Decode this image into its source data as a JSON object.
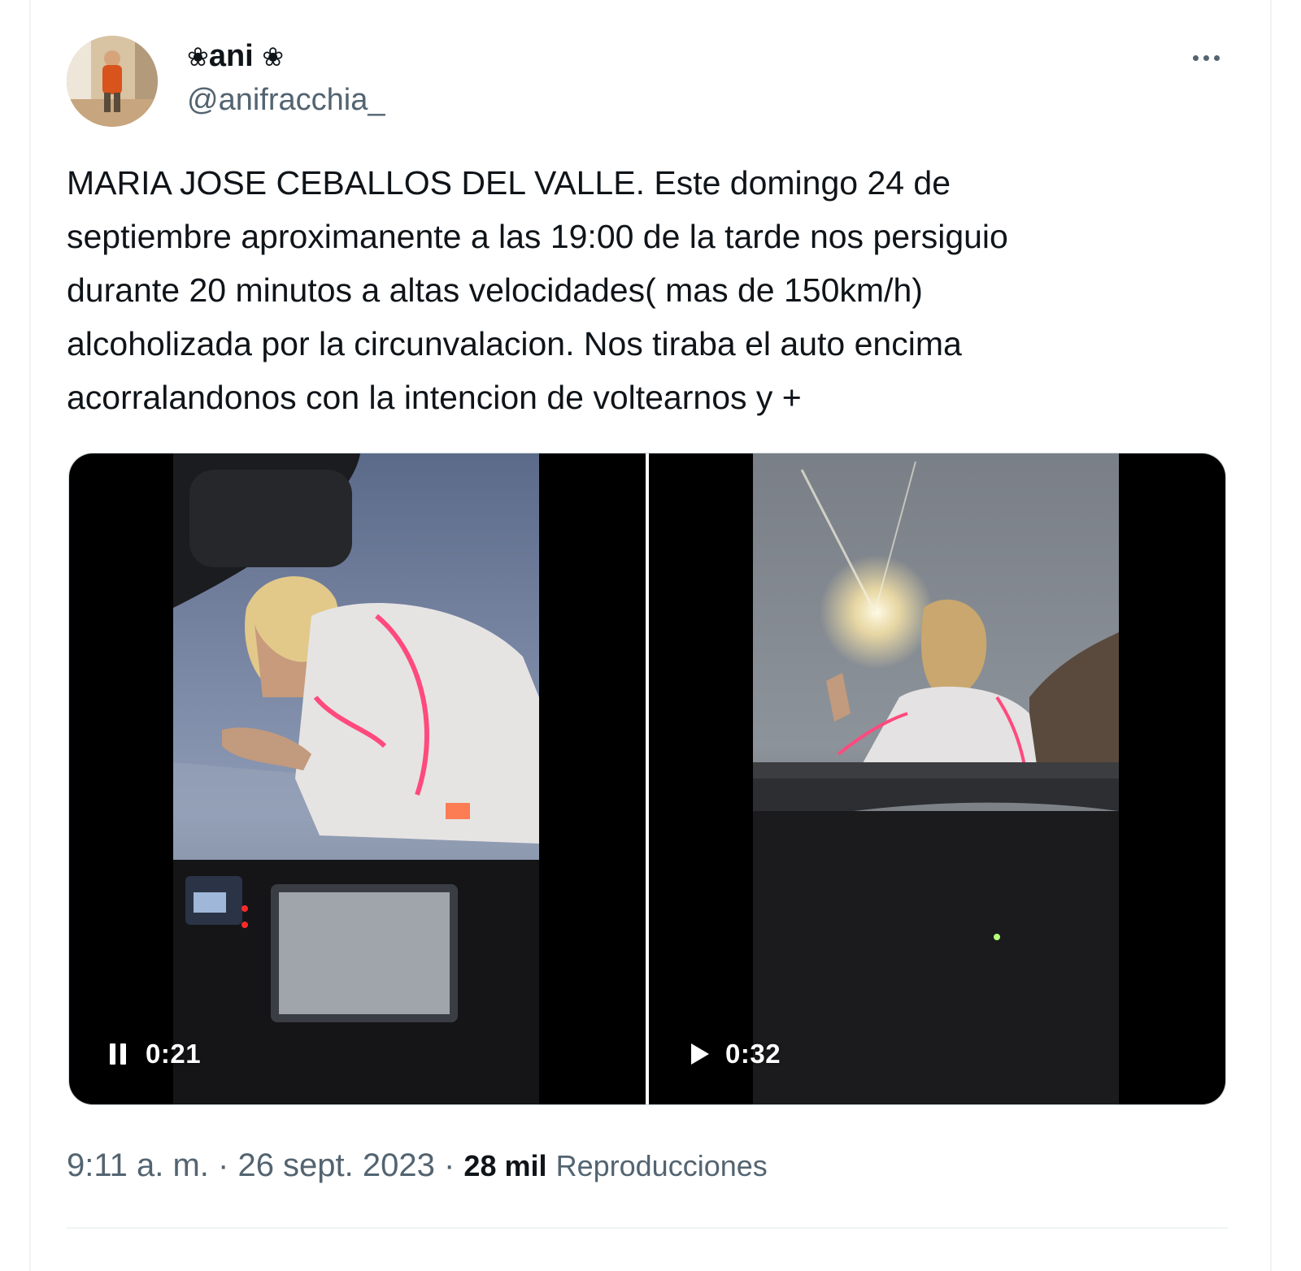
{
  "author": {
    "display_name": "ani",
    "flower_prefix": "❀",
    "flower_suffix": "❀",
    "handle": "@anifracchia_",
    "avatar_icon": "avatar-photo"
  },
  "more_icon": "more-horizontal-icon",
  "tweet": {
    "text": "MARIA JOSE CEBALLOS DEL VALLE. Este domingo 24 de\nseptiembre aproximanente a las 19:00 de la tarde nos persiguio\ndurante 20 minutos a altas velocidades( mas de 150km/h)\nalcoholizada por la circunvalacion. Nos tiraba el auto encima\nacorralandonos con la intencion de voltearnos y +"
  },
  "media": [
    {
      "state_icon": "pause-icon",
      "state": "playing",
      "duration": "0:21"
    },
    {
      "state_icon": "play-icon",
      "state": "paused",
      "duration": "0:32"
    }
  ],
  "meta": {
    "time": "9:11 a. m.",
    "separator": " · ",
    "date": "26 sept. 2023",
    "views_count": "28 mil",
    "views_label": "Reproducciones"
  },
  "colors": {
    "text_primary": "#0f1419",
    "text_secondary": "#536471",
    "divider": "#eff3f4"
  }
}
